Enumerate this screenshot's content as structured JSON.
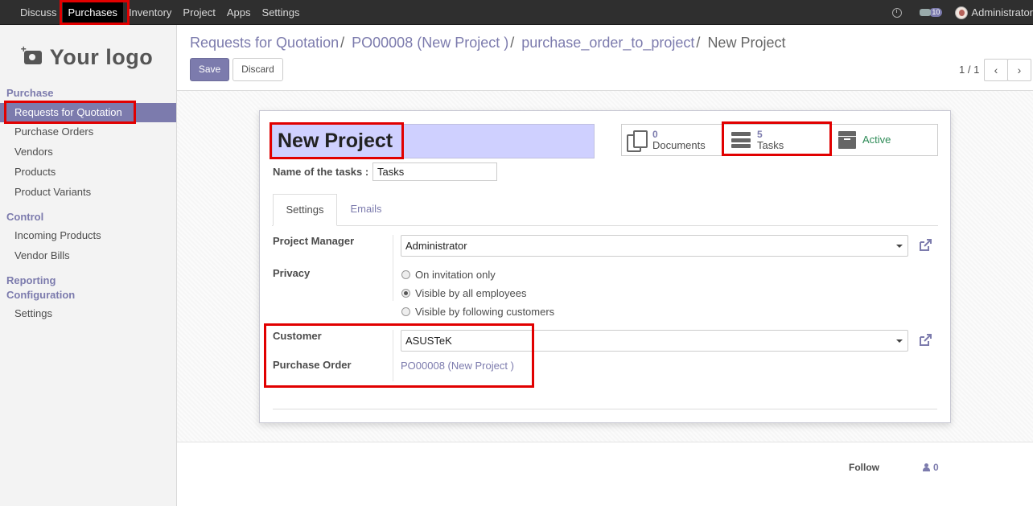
{
  "topnav": {
    "menu": [
      "Discuss",
      "Purchases",
      "Inventory",
      "Project",
      "Apps",
      "Settings"
    ],
    "active": "Purchases",
    "messages_badge": "10",
    "user": "Administrator"
  },
  "sidebar": {
    "logo_text": "Your logo",
    "sections": [
      {
        "title": "Purchase",
        "items": [
          "Requests for Quotation",
          "Purchase Orders",
          "Vendors",
          "Products",
          "Product Variants"
        ]
      },
      {
        "title": "Control",
        "items": [
          "Incoming Products",
          "Vendor Bills"
        ]
      },
      {
        "title": "Reporting",
        "items": []
      },
      {
        "title": "Configuration",
        "items": [
          "Settings"
        ]
      }
    ],
    "active_item": "Requests for Quotation"
  },
  "breadcrumb": {
    "items": [
      "Requests for Quotation",
      "PO00008 (New Project )",
      "purchase_order_to_project"
    ],
    "current": "New Project"
  },
  "buttons": {
    "save": "Save",
    "discard": "Discard"
  },
  "pager": {
    "value": "1 / 1",
    "prev": "‹",
    "next": "›"
  },
  "form": {
    "project_name": "New Project",
    "name_of_tasks_label": "Name of the tasks :",
    "name_of_tasks_value": "Tasks",
    "smart_buttons": {
      "documents": {
        "count": "0",
        "label": "Documents"
      },
      "tasks": {
        "count": "5",
        "label": "Tasks"
      },
      "active": {
        "label": "Active"
      }
    },
    "tabs": [
      "Settings",
      "Emails"
    ],
    "project_manager_label": "Project Manager",
    "project_manager_value": "Administrator",
    "privacy_label": "Privacy",
    "privacy_options": [
      "On invitation only",
      "Visible by all employees",
      "Visible by following customers"
    ],
    "privacy_selected": "Visible by all employees",
    "customer_label": "Customer",
    "customer_value": "ASUSTeK",
    "purchase_order_label": "Purchase Order",
    "purchase_order_value": "PO00008 (New Project )"
  },
  "chatter": {
    "follow": "Follow",
    "followers": "0"
  },
  "colors": {
    "brand": "#7c7bad",
    "highlight": "#e10000",
    "title_bg": "#cfd0ff",
    "navbar": "#2f2f2f"
  }
}
